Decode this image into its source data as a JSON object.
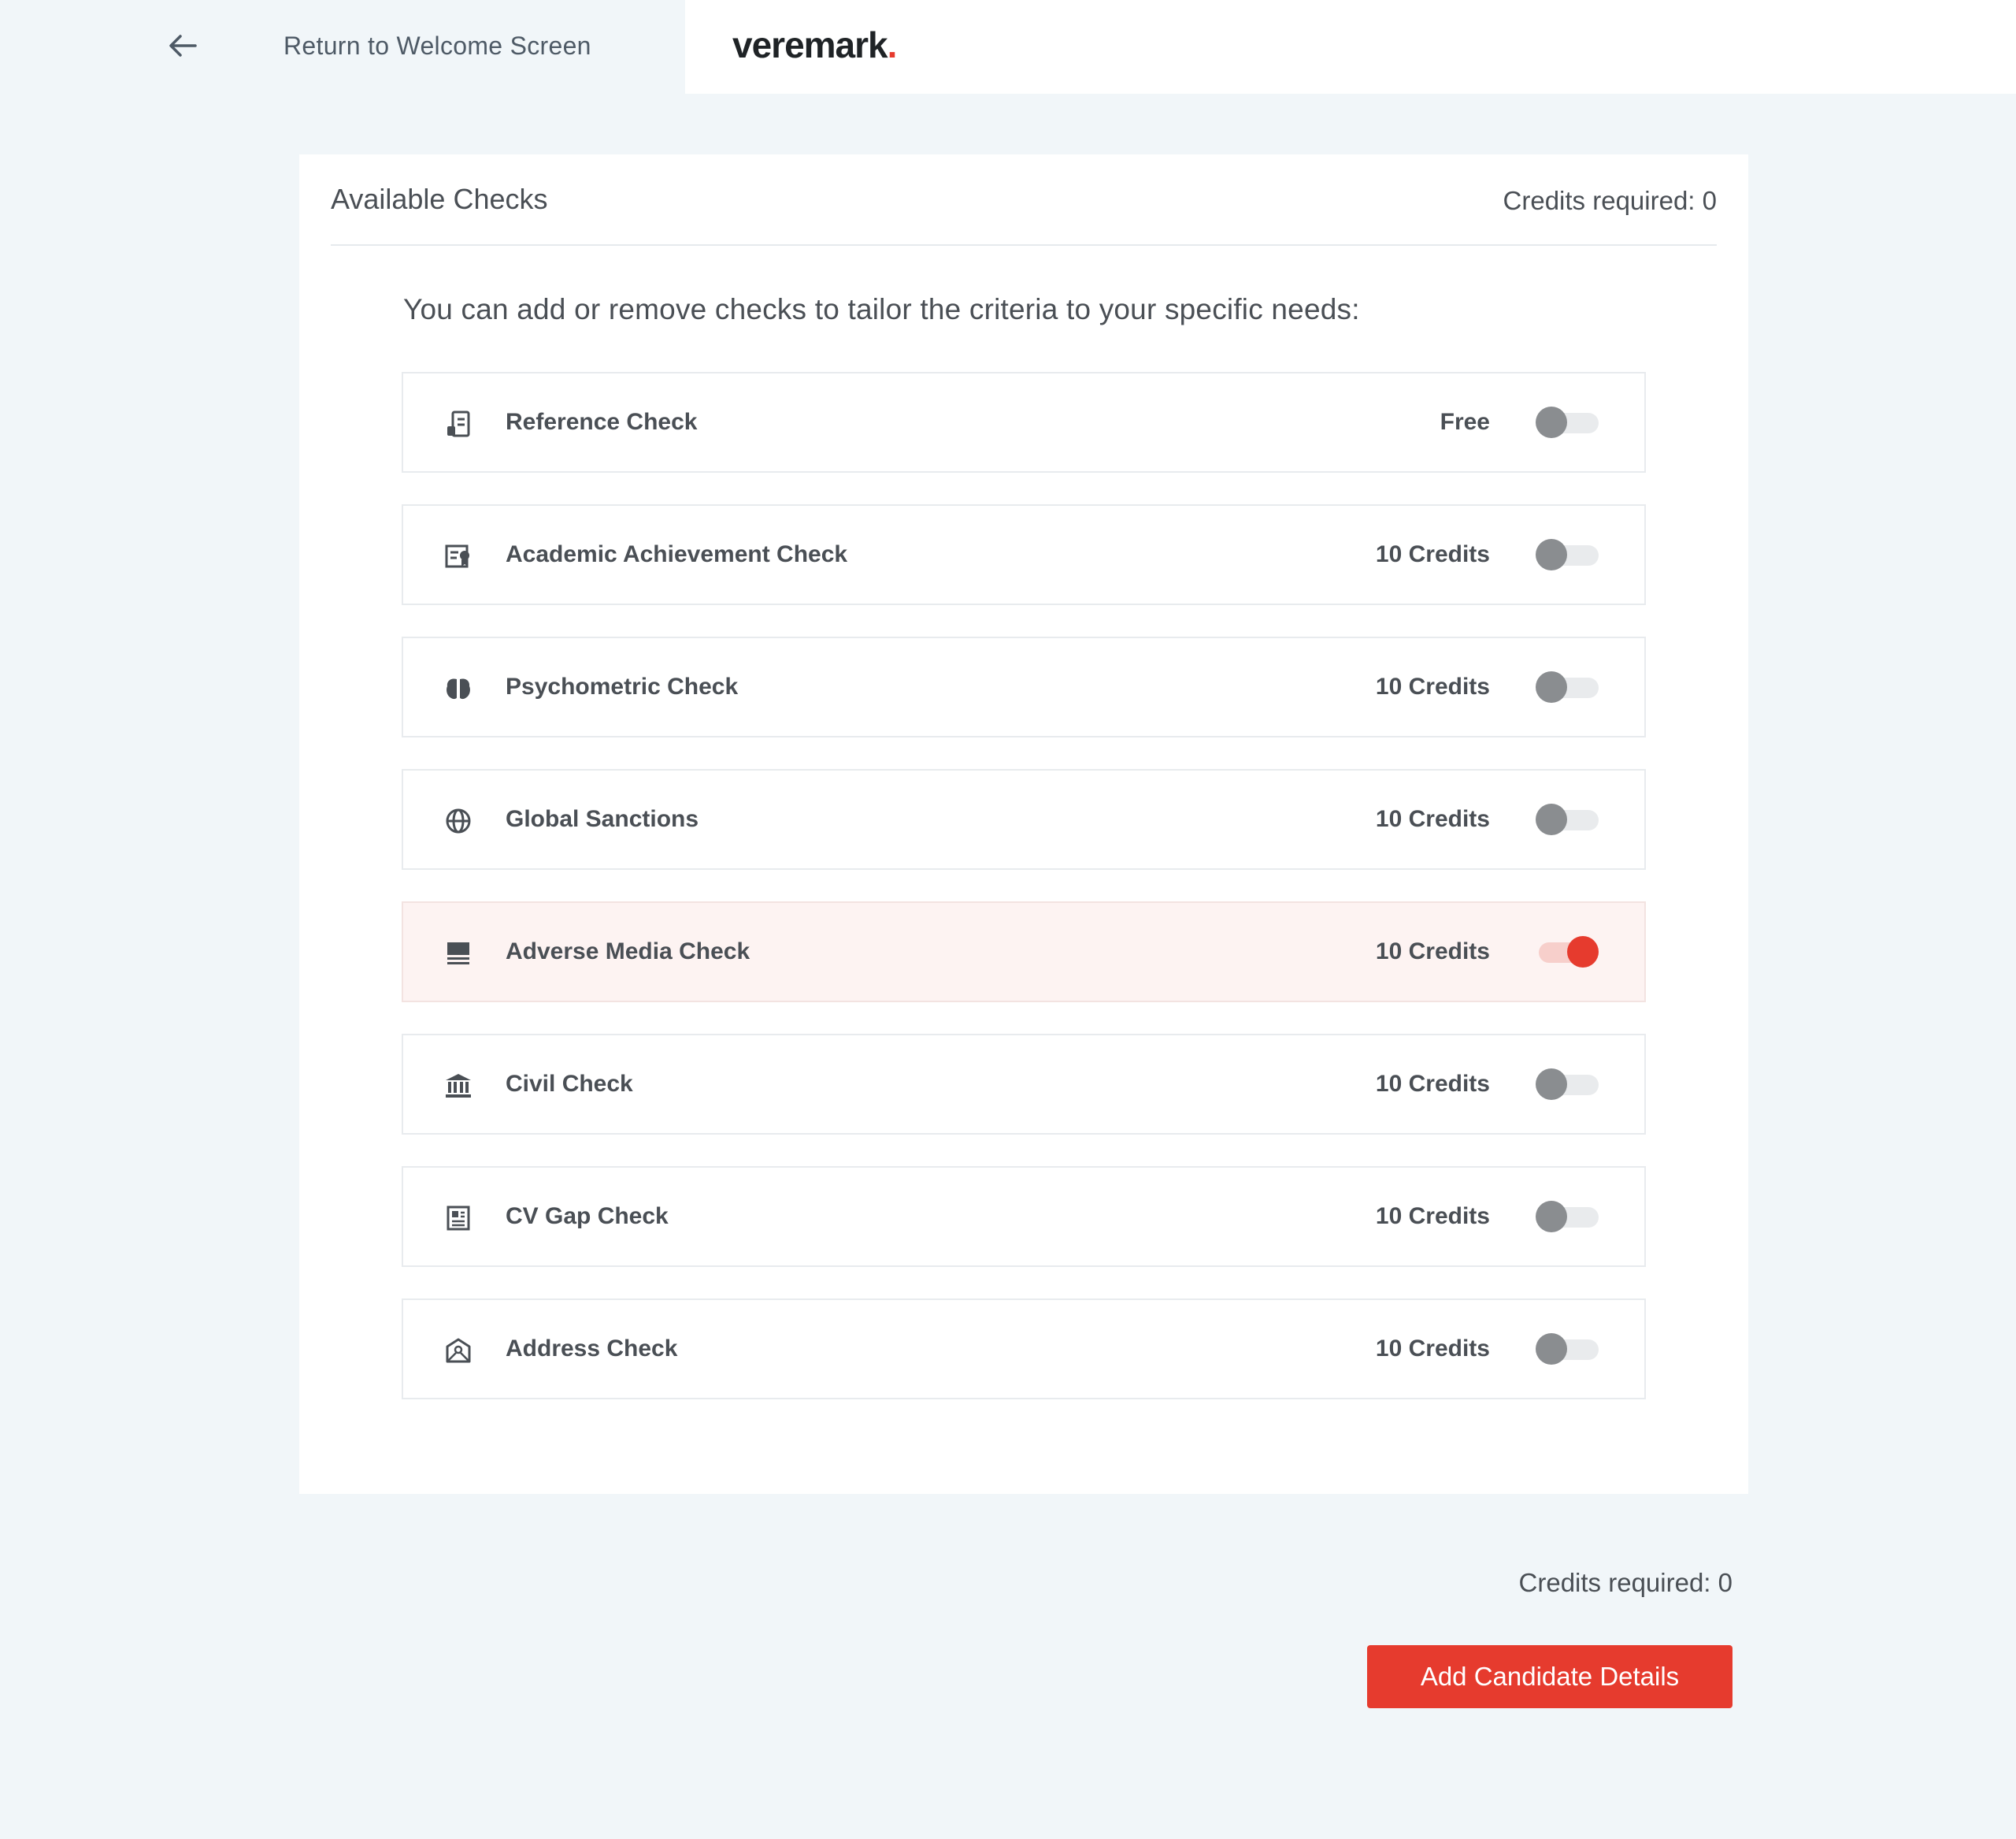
{
  "header": {
    "back_label": "Return to Welcome Screen",
    "logo_text": "veremark",
    "logo_dot": "."
  },
  "card": {
    "title": "Available Checks",
    "credits_required": "Credits required: 0",
    "intro": "You can add or remove checks to tailor the criteria to your specific needs:"
  },
  "checks": [
    {
      "label": "Reference Check",
      "price": "Free",
      "icon": "reference-icon",
      "enabled": false
    },
    {
      "label": "Academic Achievement Check",
      "price": "10 Credits",
      "icon": "certificate-icon",
      "enabled": false
    },
    {
      "label": "Psychometric Check",
      "price": "10 Credits",
      "icon": "brain-icon",
      "enabled": false
    },
    {
      "label": "Global Sanctions",
      "price": "10 Credits",
      "icon": "globe-icon",
      "enabled": false
    },
    {
      "label": "Adverse Media Check",
      "price": "10 Credits",
      "icon": "media-icon",
      "enabled": true
    },
    {
      "label": "Civil Check",
      "price": "10 Credits",
      "icon": "courthouse-icon",
      "enabled": false
    },
    {
      "label": "CV Gap Check",
      "price": "10 Credits",
      "icon": "document-icon",
      "enabled": false
    },
    {
      "label": "Address Check",
      "price": "10 Credits",
      "icon": "address-icon",
      "enabled": false
    }
  ],
  "footer": {
    "credits_required": "Credits required: 0",
    "button_label": "Add Candidate Details"
  },
  "colors": {
    "accent": "#e63b2e",
    "background": "#f1f6f9",
    "active_row": "#fdf3f2"
  }
}
